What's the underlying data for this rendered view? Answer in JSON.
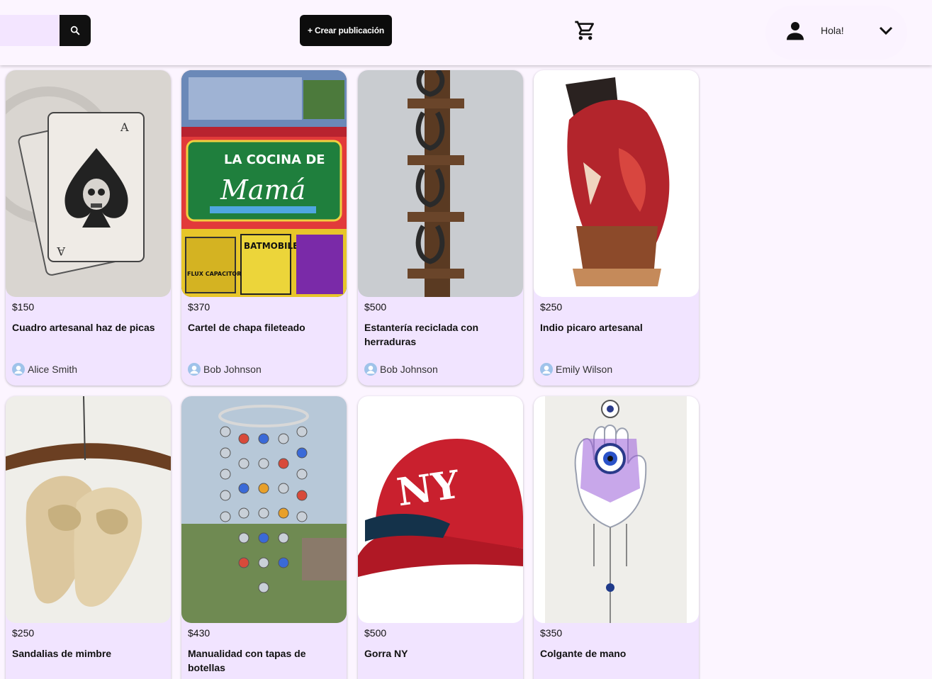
{
  "header": {
    "search": {
      "value": "",
      "placeholder": ""
    },
    "search_icon": "search-icon",
    "create_label": "+ Crear publicación",
    "cart_icon": "cart-icon",
    "user_icon": "user-icon",
    "greeting": "Hola!",
    "menu_icon": "chevron-down-icon"
  },
  "products": [
    {
      "price": "$150",
      "title": "Cuadro artesanal haz de picas",
      "seller": "Alice Smith",
      "image": "ace-of-spades-skull-drawing"
    },
    {
      "price": "$370",
      "title": "Cartel de chapa fileteado",
      "seller": "Bob Johnson",
      "image": "la-cocina-de-mama-sign"
    },
    {
      "price": "$500",
      "title": "Estantería reciclada con herraduras",
      "seller": "Bob Johnson",
      "image": "horseshoe-wooden-shelf"
    },
    {
      "price": "$250",
      "title": "Indio picaro artesanal",
      "seller": "Emily Wilson",
      "image": "carved-wooden-figure"
    },
    {
      "price": "$250",
      "title": "Sandalias de mimbre",
      "seller": "",
      "image": "woven-sandals"
    },
    {
      "price": "$430",
      "title": "Manualidad con tapas de botellas",
      "seller": "",
      "image": "bottle-cap-wind-chime"
    },
    {
      "price": "$500",
      "title": "Gorra NY",
      "seller": "",
      "image": "red-ny-cap"
    },
    {
      "price": "$350",
      "title": "Colgante de mano",
      "seller": "",
      "image": "hamsa-hand-pendant"
    }
  ],
  "colors": {
    "background": "#fcf5ff",
    "card": "#f1e4ff",
    "button": "#0c0c0c",
    "search_field": "#f3e5ff"
  }
}
